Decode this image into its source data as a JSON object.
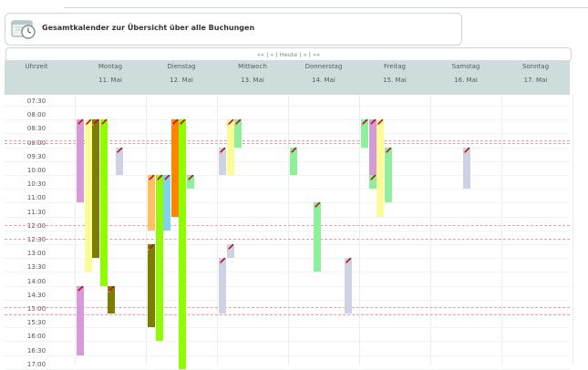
{
  "title": "Gesamtkalender zur Übersicht über alle Buchungen",
  "nav": {
    "first": "««",
    "prev": "«",
    "today": "Heute",
    "next": "»",
    "last": "»»",
    "sep": "|"
  },
  "header": {
    "time_label": "Uhrzeit",
    "days": [
      {
        "day": "Montag",
        "date": "11. Mai"
      },
      {
        "day": "Dienstag",
        "date": "12. Mai"
      },
      {
        "day": "Mittwoch",
        "date": "13. Mai"
      },
      {
        "day": "Donnerstag",
        "date": "14. Mai"
      },
      {
        "day": "Freitag",
        "date": "15. Mai"
      },
      {
        "day": "Samstag",
        "date": "16. Mai"
      },
      {
        "day": "Sonntag",
        "date": "17. Mai"
      }
    ]
  },
  "times": [
    "07:30",
    "08:00",
    "08:30",
    "09:00",
    "09:30",
    "10:00",
    "10:30",
    "11:00",
    "11:30",
    "12:00",
    "12:30",
    "13:00",
    "13:30",
    "14:00",
    "14:30",
    "15:00",
    "15:30",
    "16:00",
    "16:30",
    "17:00"
  ],
  "colors": {
    "violet": "#d79ad9",
    "yellow": "#fcfc96",
    "olive": "#7b7e00",
    "lime": "#8ffc00",
    "lightgreen": "#8ef09a",
    "grey": "#cdd3e2",
    "orange": "#ff8400",
    "lightorange": "#ffc163",
    "skyblue": "#7fd3ee",
    "redline": "#f09aa5",
    "header_bg": "#cfdcdc"
  },
  "bookings": [
    {
      "day": 0,
      "lane": 0,
      "start": "08:00",
      "end": "11:00",
      "color": "violet"
    },
    {
      "day": 0,
      "lane": 1,
      "start": "08:00",
      "end": "13:30",
      "color": "yellow"
    },
    {
      "day": 0,
      "lane": 2,
      "start": "08:00",
      "end": "13:00",
      "color": "olive"
    },
    {
      "day": 0,
      "lane": 3,
      "start": "08:00",
      "end": "14:00",
      "color": "lime"
    },
    {
      "day": 0,
      "lane": 5,
      "start": "09:00",
      "end": "10:00",
      "color": "grey"
    },
    {
      "day": 0,
      "lane": 0,
      "start": "14:00",
      "end": "16:30",
      "color": "violet"
    },
    {
      "day": 0,
      "lane": 4,
      "start": "14:00",
      "end": "15:00",
      "color": "olive"
    },
    {
      "day": 1,
      "lane": 0,
      "start": "10:00",
      "end": "12:00",
      "color": "lightorange"
    },
    {
      "day": 1,
      "lane": 1,
      "start": "10:00",
      "end": "16:00",
      "color": "lime"
    },
    {
      "day": 1,
      "lane": 2,
      "start": "10:00",
      "end": "12:00",
      "color": "skyblue"
    },
    {
      "day": 1,
      "lane": 3,
      "start": "08:00",
      "end": "11:30",
      "color": "orange"
    },
    {
      "day": 1,
      "lane": 4,
      "start": "08:00",
      "end": "17:00",
      "color": "lime"
    },
    {
      "day": 1,
      "lane": 5,
      "start": "10:00",
      "end": "10:30",
      "color": "lightgreen"
    },
    {
      "day": 1,
      "lane": 0,
      "start": "12:30",
      "end": "15:30",
      "color": "olive"
    },
    {
      "day": 2,
      "lane": 0,
      "start": "09:00",
      "end": "10:00",
      "color": "grey"
    },
    {
      "day": 2,
      "lane": 1,
      "start": "08:00",
      "end": "10:00",
      "color": "yellow"
    },
    {
      "day": 2,
      "lane": 2,
      "start": "08:00",
      "end": "09:00",
      "color": "lightgreen"
    },
    {
      "day": 2,
      "lane": 1,
      "start": "12:30",
      "end": "13:00",
      "color": "grey"
    },
    {
      "day": 2,
      "lane": 0,
      "start": "13:00",
      "end": "15:00",
      "color": "grey"
    },
    {
      "day": 3,
      "lane": 0,
      "start": "09:00",
      "end": "10:00",
      "color": "lightgreen"
    },
    {
      "day": 3,
      "lane": 3,
      "start": "11:00",
      "end": "13:30",
      "color": "lightgreen"
    },
    {
      "day": 3,
      "lane": 7,
      "start": "13:00",
      "end": "15:00",
      "color": "grey"
    },
    {
      "day": 4,
      "lane": 0,
      "start": "08:00",
      "end": "09:00",
      "color": "lightgreen"
    },
    {
      "day": 4,
      "lane": 1,
      "start": "08:00",
      "end": "10:00",
      "color": "violet"
    },
    {
      "day": 4,
      "lane": 2,
      "start": "08:00",
      "end": "11:30",
      "color": "yellow"
    },
    {
      "day": 4,
      "lane": 3,
      "start": "09:00",
      "end": "11:00",
      "color": "lightgreen"
    },
    {
      "day": 4,
      "lane": 1,
      "start": "10:00",
      "end": "10:30",
      "color": "lightgreen"
    },
    {
      "day": 5,
      "lane": 4,
      "start": "09:00",
      "end": "10:30",
      "color": "grey"
    }
  ]
}
